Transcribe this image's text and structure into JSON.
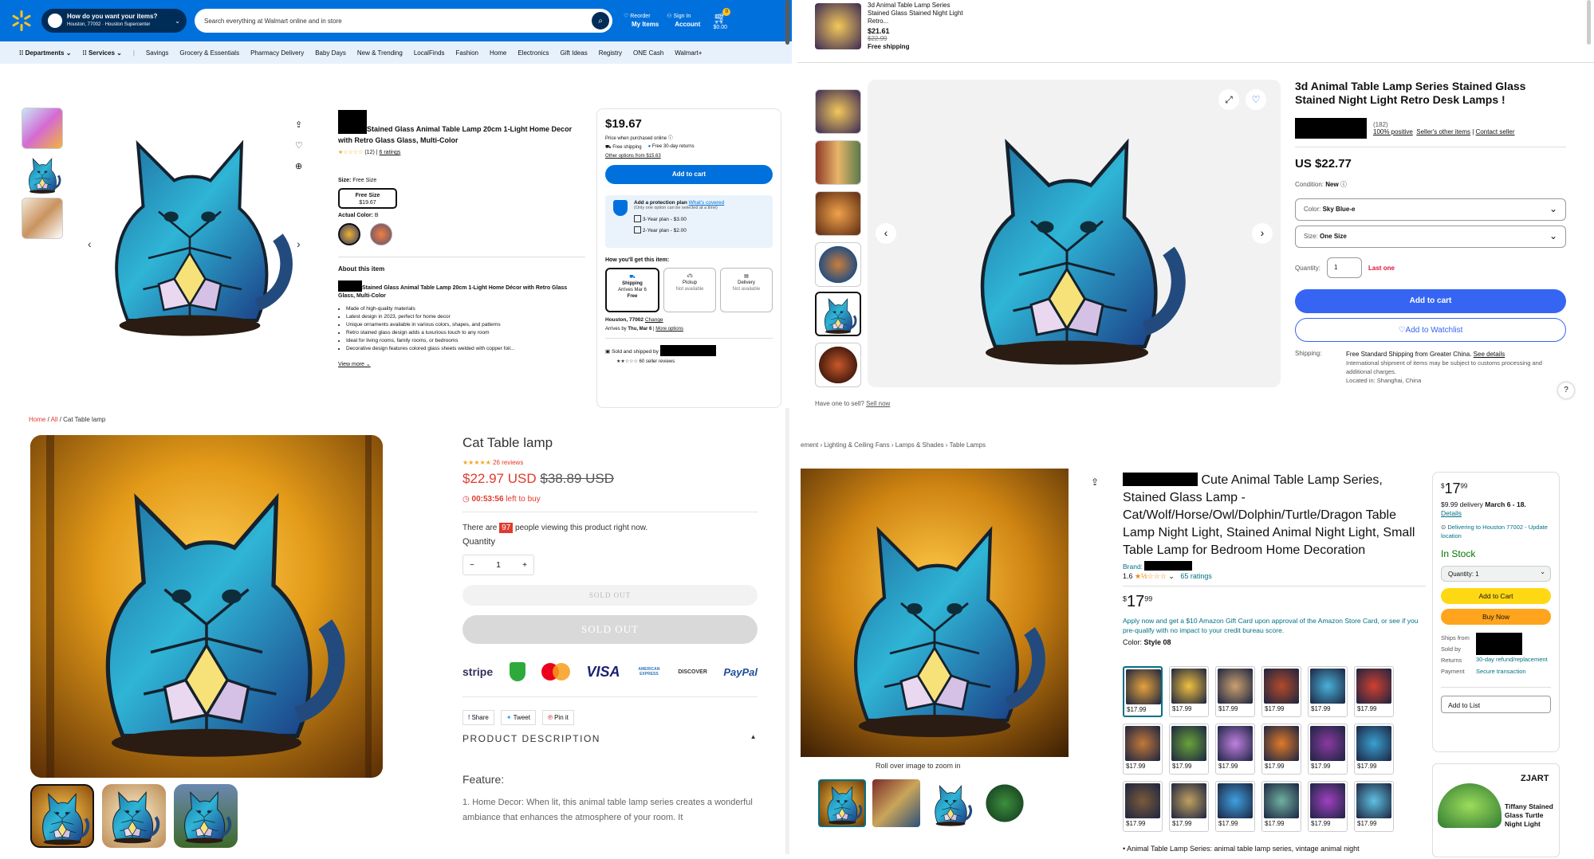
{
  "walmart": {
    "spark_color": "#ffc220",
    "brand_color": "#0071dc",
    "delivery_q": "How do you want your items?",
    "delivery_loc": "Houston, 77002 · Houston Supercenter",
    "search_placeholder": "Search everything at Walmart online and in store",
    "reorder": "Reorder",
    "my_items": "My Items",
    "sign_in": "Sign In",
    "account": "Account",
    "cart_count": "0",
    "cart_total": "$0.00",
    "departments": "Departments",
    "services": "Services",
    "nav": [
      "Savings",
      "Grocery & Essentials",
      "Pharmacy Delivery",
      "Baby Days",
      "New & Trending",
      "LocalFinds",
      "Fashion",
      "Home",
      "Electronics",
      "Gift Ideas",
      "Registry",
      "ONE Cash",
      "Walmart+"
    ],
    "title": "Stained Glass Animal Table Lamp 20cm 1-Light Home Decor with Retro Glass Glass, Multi-Color",
    "rating_count": "(12)",
    "ratings_link": "6 ratings",
    "size_label": "Size:",
    "size_value": "Free Size",
    "size_chip_name": "Free Size",
    "size_chip_price": "$19.67",
    "actual_color": "Actual Color:",
    "actual_color_value": "B",
    "about": "About this item",
    "about_title": "Stained Glass Animal Table Lamp 20cm 1-Light Home Décor with Retro Glass Glass, Multi-Color",
    "bullets": [
      "Made of high-quality materials",
      "Latest design in 2023, perfect for home decor",
      "Unique ornaments available in various colors, shapes, and patterns",
      "Retro stained glass design adds a luxurious touch to any room",
      "Ideal for living rooms, family rooms, or bedrooms",
      "Decorative design features colored glass sheets welded with copper foil..."
    ],
    "view_more": "View more",
    "price": "$19.67",
    "price_note": "Price when purchased online",
    "free_shipping": "Free shipping",
    "free_returns": "Free 30-day returns",
    "other_options": "Other options from $15.63",
    "add_to_cart": "Add to cart",
    "protection_title": "Add a protection plan",
    "whats_covered": "What's covered",
    "protection_note": "(Only one option can be selected at a time)",
    "plan3": "3-Year plan - $3.00",
    "plan2": "2-Year plan - $2.00",
    "get_item": "How you'll get this item:",
    "shipping": "Shipping",
    "ship_arrives": "Arrives Mar 6",
    "ship_free": "Free",
    "pickup": "Pickup",
    "pickup_na": "Not available",
    "delivery": "Delivery",
    "delivery_na": "Not available",
    "zip": "Houston, 77002",
    "change": "Change",
    "arrives": "Arrives by",
    "arrives_date": "Thu, Mar 6",
    "more_options": "More options",
    "sold_by": "Sold and shipped by",
    "seller_reviews": "60 seller reviews"
  },
  "ebay": {
    "sticky_title": "3d Animal Table Lamp Series Stained Glass Stained Night Light Retro...",
    "sticky_price": "$21.61",
    "sticky_was": "$22.99",
    "sticky_ship": "Free shipping",
    "title": "3d Animal Table Lamp Series Stained Glass Stained Night Light Retro Desk Lamps !",
    "fb_count": "(182)",
    "positive": "100% positive",
    "sellers_items": "Seller's other items",
    "contact": "Contact seller",
    "price": "US $22.77",
    "condition_label": "Condition:",
    "condition": "New",
    "color_label": "Color:",
    "color": "Sky Blue-e",
    "size_label": "Size:",
    "size": "One Size",
    "qty_label": "Quantity:",
    "qty": "1",
    "last_one": "Last one",
    "add_to_cart": "Add to cart",
    "watchlist": "Add to Watchlist",
    "shipping_label": "Shipping:",
    "shipping": "Free Standard Shipping from Greater China.",
    "see_details": "See details",
    "ship_note": "International shipment of items may be subject to customs processing and additional charges.",
    "located": "Located in: Shanghai, China",
    "sell_prompt": "Have one to sell?",
    "sell_now": "Sell now",
    "help": "?"
  },
  "shop": {
    "breadcrumb": [
      "Home",
      "All",
      "Cat Table lamp"
    ],
    "title": "Cat Table lamp",
    "reviews": "26 reviews",
    "price": "$22.97 USD",
    "compare": "$38.89 USD",
    "timer": "00:53:56",
    "left_to_buy": "left to buy",
    "viewing_pre": "There are",
    "viewing_count": "97",
    "viewing_post": "people viewing this product right now.",
    "qty_label": "Quantity",
    "qty": "1",
    "minus": "−",
    "plus": "+",
    "sold_out_1": "SOLD OUT",
    "sold_out_2": "SOLD OUT",
    "payment": [
      "stripe",
      "",
      "mastercard",
      "VISA",
      "AMERICAN EXPRESS",
      "DISCOVER",
      "PayPal"
    ],
    "share": "Share",
    "tweet": "Tweet",
    "pin": "Pin it",
    "desc_heading": "PRODUCT DESCRIPTION",
    "feature": "Feature:",
    "desc_text": "1. Home Decor: When lit, this animal table lamp series creates a wonderful ambiance that enhances the atmosphere of your room. It"
  },
  "amazon": {
    "breadcrumb": [
      "ement",
      "Lighting & Ceiling Fans",
      "Lamps & Shades",
      "Table Lamps"
    ],
    "title": "Cute Animal Table Lamp Series, Stained Glass Lamp - Cat/Wolf/Horse/Owl/Dolphin/Turtle/Dragon Table Lamp Night Light, Stained Animal Night Light, Small Table Lamp for Bedroom Home Decoration",
    "brand_label": "Brand:",
    "rating": "1.6",
    "ratings": "65 ratings",
    "price_whole": "17",
    "price_frac": "99",
    "price_sym": "$",
    "card_offer": "Apply now and get a $10 Amazon Gift Card upon approval of the Amazon Store Card, or see if you pre-qualify with no impact to your credit bureau score.",
    "color_label": "Color:",
    "color": "Style 08",
    "swatch_price": "$17.99",
    "zoom_hint": "Roll over image to zoom in",
    "box_delivery": "$9.99 delivery",
    "box_dates": "March 6 - 18.",
    "details": "Details",
    "deliver_to": "Delivering to Houston 77002 - Update location",
    "in_stock": "In Stock",
    "qty": "Quantity: 1",
    "add_to_cart": "Add to Cart",
    "buy_now": "Buy Now",
    "ships_from": "Ships from",
    "sold_by": "Sold by",
    "returns": "Returns",
    "returns_val": "30-day refund/replacement",
    "payment": "Payment",
    "payment_val": "Secure transaction",
    "add_to_list": "Add to List",
    "bullet": "Animal Table Lamp Series: animal table lamp series, vintage animal night",
    "ad_brand": "ZJART",
    "ad_title": "Tiffany Stained Glass Turtle Night Light"
  }
}
